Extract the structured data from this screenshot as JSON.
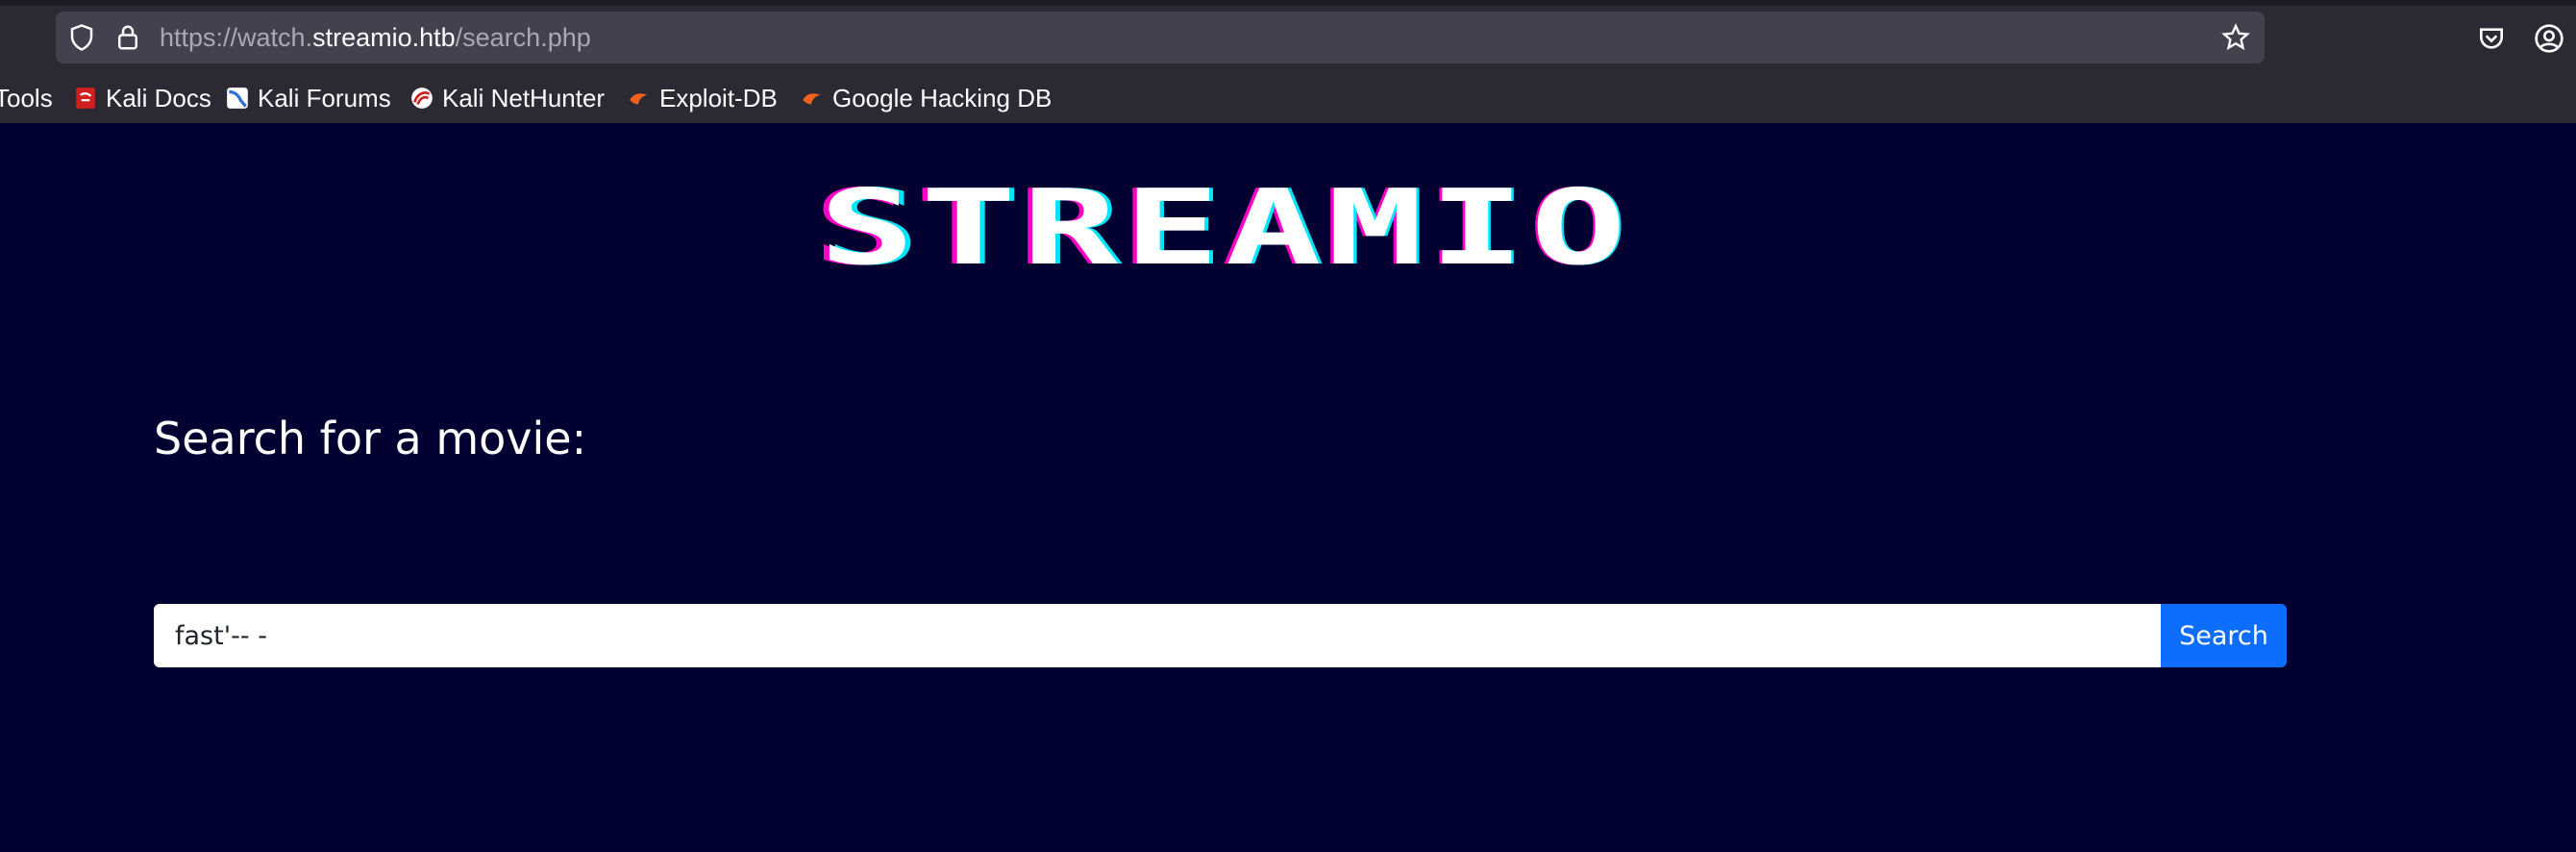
{
  "browser": {
    "url_prefix": "https://watch.",
    "url_domain": "streamio.htb",
    "url_path": "/search.php",
    "bookmarks": [
      {
        "label": "Tools",
        "icon": "none"
      },
      {
        "label": "Kali Docs",
        "icon": "kali-docs-icon"
      },
      {
        "label": "Kali Forums",
        "icon": "kali-forums-icon"
      },
      {
        "label": "Kali NetHunter",
        "icon": "kali-nethunter-icon"
      },
      {
        "label": "Exploit-DB",
        "icon": "exploit-db-icon"
      },
      {
        "label": "Google Hacking DB",
        "icon": "exploit-db-icon"
      }
    ]
  },
  "page": {
    "logo_text": "STREAMIO",
    "search_heading": "Search for a movie:",
    "search_value": "fast'-- -",
    "search_button_label": "Search"
  },
  "colors": {
    "page_background": "#020030",
    "button_blue": "#0d6efd",
    "logo_magenta": "#ff00c8",
    "logo_cyan": "#00e5ff"
  }
}
